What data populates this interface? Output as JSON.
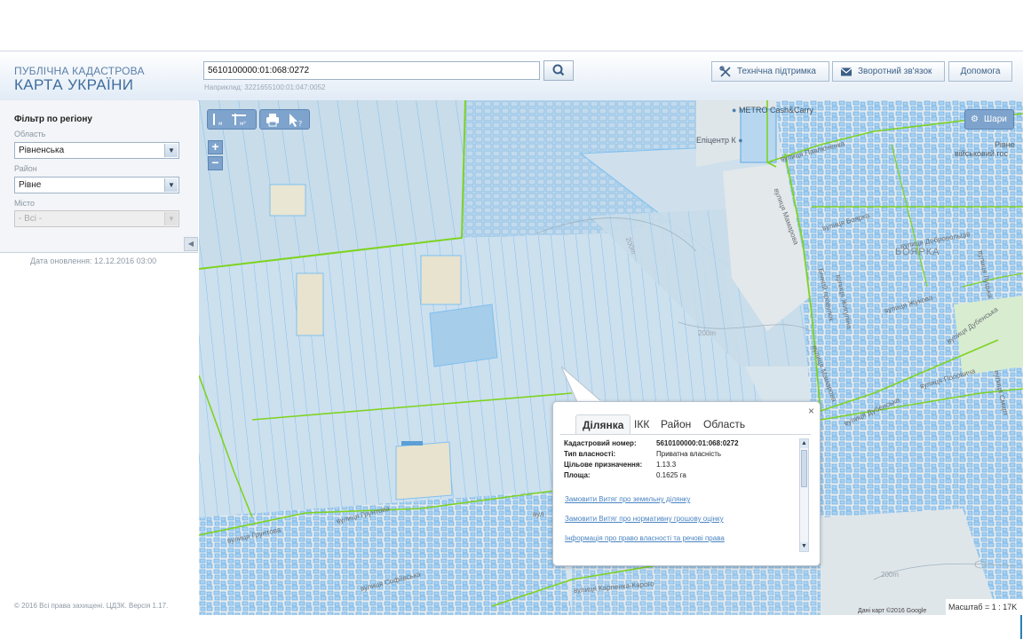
{
  "header": {
    "brand_line1": "ПУБЛІЧНА КАДАСТРОВА",
    "brand_line2": "КАРТА УКРАЇНИ",
    "search": {
      "value": "5610100000:01:068:0272",
      "hint": "Наприклад: 3221655100:01:047:0052"
    },
    "buttons": {
      "support": "Технічна підтримка",
      "feedback": "Зворотний зв'язок",
      "help": "Допомога"
    }
  },
  "sidebar": {
    "filter_title": "Фільтр по регіону",
    "oblast_label": "Область",
    "oblast_value": "Рівненська",
    "rayon_label": "Район",
    "rayon_value": "Рівне",
    "city_label": "Місто",
    "city_value": "- Всі -",
    "update_date": "Дата оновлення: 12.12.2016 03:00",
    "copyright": "© 2016 Всі права захищені. ЦДЗК. Версія 1.17."
  },
  "map": {
    "toolbar": {
      "zoom_in": "+",
      "zoom_out": "−",
      "layers": "Шари"
    },
    "labels": {
      "metro": "METRO Cash&Carry",
      "epicentr": "Епіцентр К",
      "boyarka": "БОЯРКА",
      "rivne_mil_1": "Рівне",
      "rivne_mil_2": "військовий гос",
      "st_pavlyuchenko": "вулиця Павлюченка",
      "st_boyarka": "вулиця Боярка",
      "st_dobrovol": "вулиця Добровольців",
      "st_mamorova_1": "вулиця Мамарова",
      "st_mamorova_2": "вулиця Мамарова",
      "st_zhukova": "вулиця Жукова",
      "st_popovycha": "вулиця Поповича",
      "st_dubenska_1": "вулиця Дубенська",
      "st_dubenska_2": "вулиця Дубенська",
      "st_hruntova_1": "вулиця Грунтова",
      "st_hruntova_2": "вулиця Грунтова",
      "st_karpenka": "вулиця Карпенка-Карого",
      "st_sofiivska": "вулиця Софіївська",
      "st_bich_pr": "Бічний провулок",
      "st_zhyhulina": "вулиця Жигуліна",
      "st_lutska": "вулиця Луцька",
      "st_smart": "вулиця Смарт",
      "st_vul": "вул",
      "elev_200_1": "200m",
      "elev_200_2": "200m",
      "elev_200_3": "200m"
    },
    "attribution": "Дані карт ©2016 Google",
    "scale": "Масштаб = 1 : 17K"
  },
  "popup": {
    "tabs": [
      "Ділянка",
      "ІКК",
      "Район",
      "Область"
    ],
    "active_tab": "Ділянка",
    "fields": [
      {
        "key": "Кадастровий номер:",
        "value": "5610100000:01:068:0272"
      },
      {
        "key": "Тип власності:",
        "value": "Приватна власність"
      },
      {
        "key": "Цільове призначення:",
        "value": "1.13.3"
      },
      {
        "key": "Площа:",
        "value": "0.1625 га"
      }
    ],
    "links": [
      "Замовити Витяг про земельну ділянку",
      "Замовити Витяг про нормативну грошову оцінку",
      "Інформація про право власності та речові права"
    ],
    "close": "×"
  },
  "colors": {
    "parcel_stroke": "#6fb6ea",
    "parcel_fill": "#c9deec",
    "boundary_green": "#7ed321",
    "toolbar_blue": "#7ea3cc",
    "brand_blue": "#3f6d9e",
    "link_blue": "#4a84c2"
  }
}
